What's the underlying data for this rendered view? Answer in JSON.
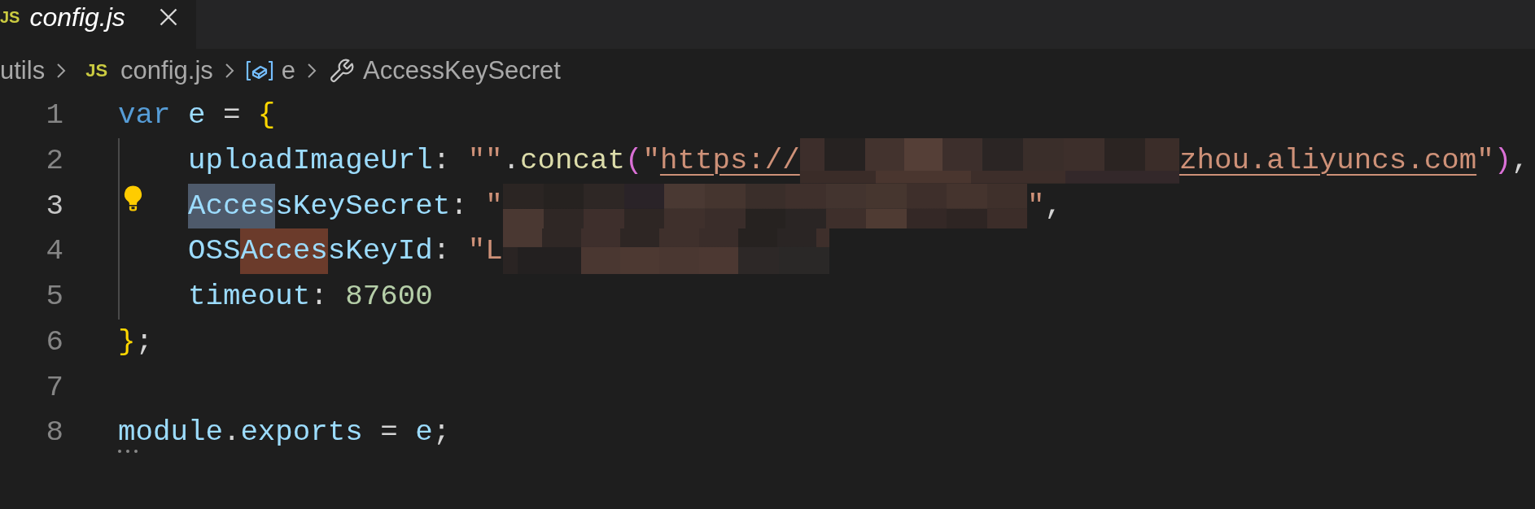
{
  "tab": {
    "icon": "JS",
    "title": "config.js",
    "selected": true,
    "preview": true
  },
  "breadcrumbs": [
    {
      "kind": "folder",
      "label": "utils"
    },
    {
      "kind": "file",
      "icon": "JS",
      "label": "config.js"
    },
    {
      "kind": "variable",
      "label": "e"
    },
    {
      "kind": "property",
      "label": "AccessKeySecret"
    }
  ],
  "lines": [
    {
      "number": "1",
      "current": false,
      "indented": false,
      "lightbulb": false,
      "hint": false,
      "tokens": [
        {
          "text": "var",
          "kind": "keyword"
        },
        {
          "text": " e",
          "kind": "variable"
        },
        {
          "text": " =",
          "kind": "operator"
        },
        {
          "text": " {",
          "kind": "bracket"
        }
      ]
    },
    {
      "number": "2",
      "current": false,
      "indented": true,
      "lightbulb": false,
      "hint": false,
      "tokens": [
        {
          "text": "uploadImageUrl",
          "kind": "property"
        },
        {
          "text": ": ",
          "kind": "punctuation"
        },
        {
          "text": "\"\"",
          "kind": "string"
        },
        {
          "text": ".",
          "kind": "punctuation"
        },
        {
          "text": "concat",
          "kind": "function"
        },
        {
          "text": "(",
          "kind": "paren"
        },
        {
          "text": "\"",
          "kind": "string"
        },
        {
          "text": "https://",
          "kind": "link"
        },
        {
          "kind": "redacted"
        },
        {
          "text": "zhou.aliyuncs.com",
          "kind": "link"
        },
        {
          "text": "\"",
          "kind": "string"
        },
        {
          "text": ")",
          "kind": "paren"
        },
        {
          "text": ",",
          "kind": "punctuation"
        }
      ]
    },
    {
      "number": "3",
      "current": true,
      "indented": true,
      "lightbulb": true,
      "hint": false,
      "tokens": [
        {
          "text": "Acces",
          "kind": "property",
          "selected": true
        },
        {
          "text": "sKeySecret",
          "kind": "property"
        },
        {
          "text": ": ",
          "kind": "punctuation"
        },
        {
          "text": "\"",
          "kind": "string"
        },
        {
          "kind": "redacted"
        },
        {
          "text": "\"",
          "kind": "string"
        },
        {
          "text": ",",
          "kind": "punctuation"
        }
      ]
    },
    {
      "number": "4",
      "current": false,
      "indented": true,
      "lightbulb": false,
      "hint": false,
      "tokens": [
        {
          "text": "OSS",
          "kind": "property"
        },
        {
          "text": "Acces",
          "kind": "property",
          "occurrence": true
        },
        {
          "text": "sKeyId",
          "kind": "property"
        },
        {
          "text": ": ",
          "kind": "punctuation"
        },
        {
          "text": "\"L",
          "kind": "string"
        },
        {
          "kind": "redacted"
        }
      ]
    },
    {
      "number": "5",
      "current": false,
      "indented": true,
      "lightbulb": false,
      "hint": false,
      "tokens": [
        {
          "text": "timeout",
          "kind": "property"
        },
        {
          "text": ": ",
          "kind": "punctuation"
        },
        {
          "text": "87600",
          "kind": "number"
        }
      ]
    },
    {
      "number": "6",
      "current": false,
      "indented": false,
      "lightbulb": false,
      "hint": false,
      "tokens": [
        {
          "text": "}",
          "kind": "bracket"
        },
        {
          "text": ";",
          "kind": "punctuation"
        }
      ]
    },
    {
      "number": "7",
      "current": false,
      "indented": false,
      "lightbulb": false,
      "hint": false
    },
    {
      "number": "8",
      "current": false,
      "indented": false,
      "lightbulb": false,
      "hint": true,
      "tokens": [
        {
          "text": "module",
          "kind": "variable"
        },
        {
          "text": ".",
          "kind": "punctuation"
        },
        {
          "text": "exports",
          "kind": "variable"
        },
        {
          "text": " =",
          "kind": "operator"
        },
        {
          "text": " e",
          "kind": "variable"
        },
        {
          "text": ";",
          "kind": "punctuation"
        }
      ]
    }
  ]
}
